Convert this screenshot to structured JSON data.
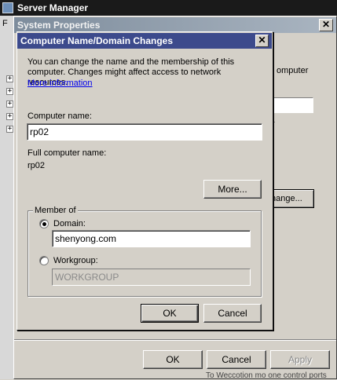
{
  "server_manager": {
    "title": "Server Manager",
    "menu_first": "F"
  },
  "system_properties": {
    "title": "System Properties",
    "frag_computer": "omputer",
    "frag_r": "r",
    "change_button": "hange...",
    "buttons": {
      "ok": "OK",
      "cancel": "Cancel",
      "apply": "Apply"
    },
    "bottom_fragment": "To Weccotion mo one control ports"
  },
  "dialog": {
    "title": "Computer Name/Domain Changes",
    "description": "You can change the name and the membership of this computer. Changes might affect access to network resources.",
    "more_info_link": "More information",
    "computer_name_label": "Computer name:",
    "computer_name_value": "rp02",
    "full_name_label": "Full computer name:",
    "full_name_value": "rp02",
    "more_button": "More...",
    "member_of": {
      "label": "Member of",
      "domain_label": "Domain:",
      "domain_value": "shenyong.com",
      "domain_selected": true,
      "workgroup_label": "Workgroup:",
      "workgroup_value": "WORKGROUP"
    },
    "ok": "OK",
    "cancel": "Cancel"
  },
  "icons": [
    "server-manager-icon",
    "close-icon",
    "tree-expand-icon"
  ]
}
